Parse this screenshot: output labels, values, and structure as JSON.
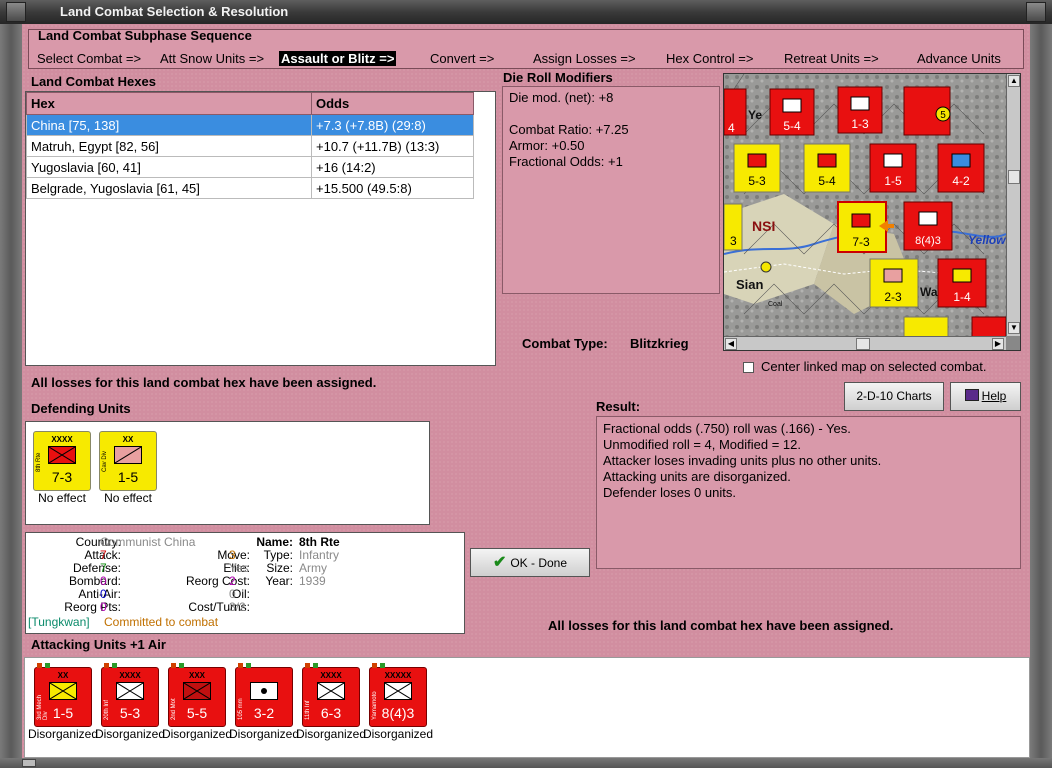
{
  "window": {
    "title": "Land Combat Selection & Resolution"
  },
  "sequence": {
    "title": "Land Combat Subphase Sequence",
    "steps": [
      "Select Combat =>",
      "Att Snow Units =>",
      "Assault or Blitz =>",
      "Convert =>",
      "Assign Losses =>",
      "Hex Control =>",
      "Retreat Units =>",
      "Advance Units"
    ],
    "active_index": 2
  },
  "hexes": {
    "label": "Land Combat Hexes",
    "columns": [
      "Hex",
      "Odds"
    ],
    "rows": [
      {
        "hex": "China [75, 138]",
        "odds": "+7.3 (+7.8B) (29:8)"
      },
      {
        "hex": "Matruh, Egypt [82, 56]",
        "odds": "+10.7 (+11.7B) (13:3)"
      },
      {
        "hex": "Yugoslavia [60, 41]",
        "odds": "+16 (14:2)"
      },
      {
        "hex": "Belgrade, Yugoslavia [61, 45]",
        "odds": "+15.500 (49.5:8)"
      }
    ]
  },
  "modifiers": {
    "label": "Die Roll Modifiers",
    "lines": [
      "Die mod. (net): +8",
      "",
      "Combat Ratio: +7.25",
      "Armor: +0.50",
      "Fractional Odds: +1"
    ]
  },
  "combat_type": {
    "label": "Combat Type:",
    "value": "Blitzkrieg"
  },
  "center_map": {
    "label": "Center linked map on selected combat.",
    "checked": false
  },
  "losses_msg": "All losses for this land combat hex have been assigned.",
  "buttons": {
    "charts": "2-D-10 Charts",
    "help": "Help",
    "ok": "OK - Done"
  },
  "result": {
    "label": "Result:",
    "lines": [
      "Fractional odds (.750) roll was (.166)  - Yes.",
      "Unmodified roll = 4, Modified = 12.",
      "Attacker loses invading units plus no other units.",
      "Attacking units are disorganized.",
      "Defender loses 0 units."
    ]
  },
  "defending": {
    "label": "Defending Units",
    "units": [
      {
        "size": "XXXX",
        "name": "8th Rte",
        "value": "7-3",
        "status": "No effect",
        "color": "yellow"
      },
      {
        "size": "XX",
        "name": "Cav Div",
        "value": "1-5",
        "status": "No effect",
        "color": "yellow"
      }
    ]
  },
  "unit_info": {
    "country_label": "Country:",
    "country": "Communist China",
    "attack_label": "Attack:",
    "attack": "7",
    "defense_label": "Defense:",
    "defense": "7",
    "bombard_label": "Bombard:",
    "bombard": "0",
    "antiair_label": "Anti-Air:",
    "antiair": "0",
    "reorgpts_label": "Reorg Pts:",
    "reorgpts": "0",
    "move_label": "Move:",
    "move": "3",
    "elite_label": "Elite:",
    "elite": "Yes",
    "reorgcost_label": "Reorg Cost:",
    "reorgcost": "2",
    "oil_label": "Oil:",
    "oil": "0",
    "costturns_label": "Cost/Turns:",
    "costturns": "3/2",
    "name_label": "Name:",
    "name": "8th Rte",
    "type_label": "Type:",
    "type": "Infantry",
    "size_label": "Size:",
    "size": "Army",
    "year_label": "Year:",
    "year": "1939",
    "location": "[Tungkwan]",
    "status": "Committed to combat"
  },
  "attacking": {
    "label": "Attacking Units +1 Air",
    "units": [
      {
        "size": "XX",
        "name": "3rd Mech Div",
        "value": "1-5",
        "status": "Disorganized"
      },
      {
        "size": "XXXX",
        "name": "20th Inf",
        "value": "5-3",
        "status": "Disorganized"
      },
      {
        "size": "XXX",
        "name": "2nd Mot",
        "value": "5-5",
        "status": "Disorganized"
      },
      {
        "size": "",
        "name": "105 mm",
        "value": "3-2",
        "status": "Disorganized"
      },
      {
        "size": "XXXX",
        "name": "11th Inf",
        "value": "6-3",
        "status": "Disorganized"
      },
      {
        "size": "XXXXX",
        "name": "Yamamoto",
        "value": "8(4)3",
        "status": "Disorganized"
      }
    ]
  },
  "map": {
    "labels": [
      "NSI",
      "Sian",
      "Yellow",
      "Coal",
      "Wa",
      "Ye"
    ],
    "counters": [
      {
        "value": "5-4",
        "color": "red"
      },
      {
        "value": "1-3",
        "color": "red"
      },
      {
        "value": "5-3",
        "color": "yellow"
      },
      {
        "value": "5-4",
        "color": "yellow"
      },
      {
        "value": "1-5",
        "color": "red"
      },
      {
        "value": "4-2",
        "color": "red"
      },
      {
        "value": "7-3",
        "color": "yellow"
      },
      {
        "value": "8(4)3",
        "color": "red"
      },
      {
        "value": "2-3",
        "color": "yellow"
      },
      {
        "value": "1-4",
        "color": "red"
      },
      {
        "value": "5",
        "color": "red"
      },
      {
        "value": "4",
        "color": "red"
      },
      {
        "value": "3",
        "color": "red"
      }
    ]
  }
}
